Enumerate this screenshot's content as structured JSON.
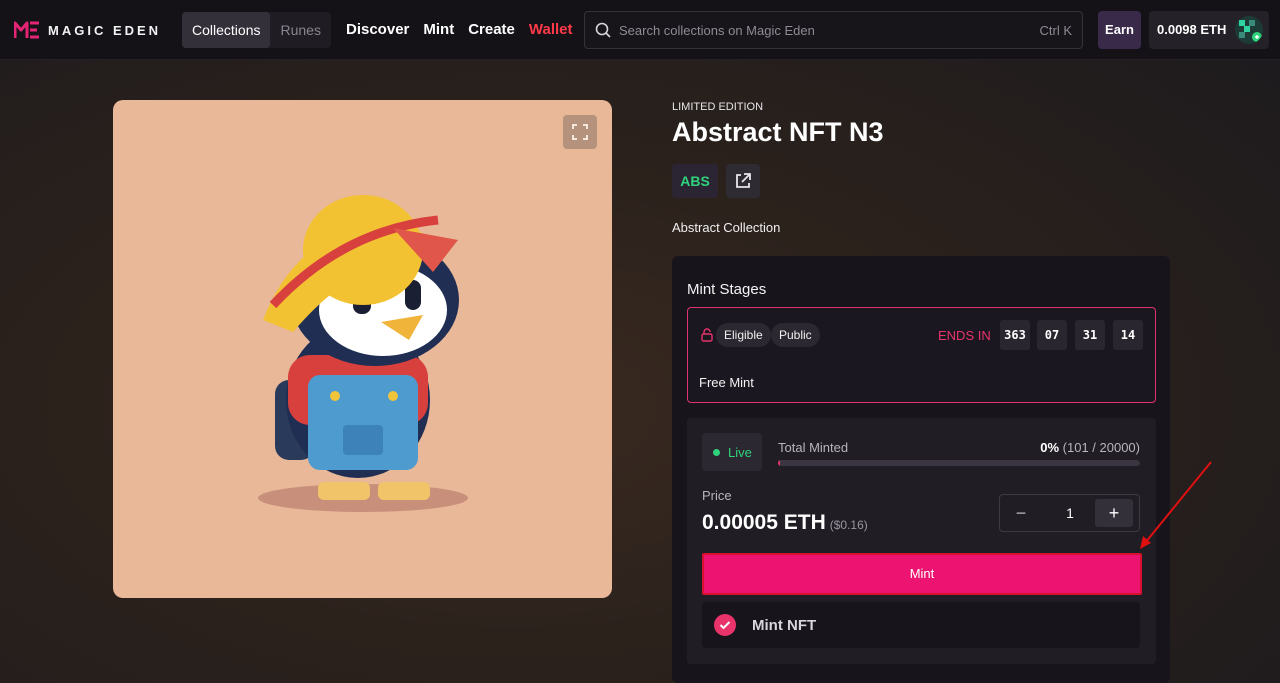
{
  "brand": {
    "name": "MAGIC EDEN",
    "logo_icon": "magic-eden-logo-icon",
    "accent": "#e8336b"
  },
  "segments": [
    {
      "label": "Collections",
      "active": true
    },
    {
      "label": "Runes",
      "active": false
    }
  ],
  "nav": {
    "discover": "Discover",
    "mint": "Mint",
    "create": "Create",
    "wallet": "Wallet"
  },
  "search": {
    "placeholder": "Search collections on Magic Eden",
    "shortcut": "Ctrl K",
    "icon": "search-icon"
  },
  "account": {
    "earn": "Earn",
    "balance": "0.0098 ETH"
  },
  "item": {
    "edition": "LIMITED EDITION",
    "title": "Abstract NFT N3",
    "chain": "ABS",
    "collection": "Abstract Collection"
  },
  "mint_stages": {
    "title": "Mint Stages",
    "tags": [
      "Eligible",
      "Public"
    ],
    "ends_label": "ENDS IN",
    "countdown": [
      "363",
      "07",
      "31",
      "14"
    ],
    "stage_name": "Free Mint"
  },
  "mint": {
    "status": "Live",
    "total_minted_label": "Total Minted",
    "percent": "0%",
    "count": "(101 / 20000)",
    "progress_fraction": 0.00505,
    "price_label": "Price",
    "price": "0.00005 ETH",
    "price_usd": "($0.16)",
    "quantity": "1",
    "minus": "−",
    "plus": "+",
    "button": "Mint",
    "step_label": "Mint NFT"
  }
}
